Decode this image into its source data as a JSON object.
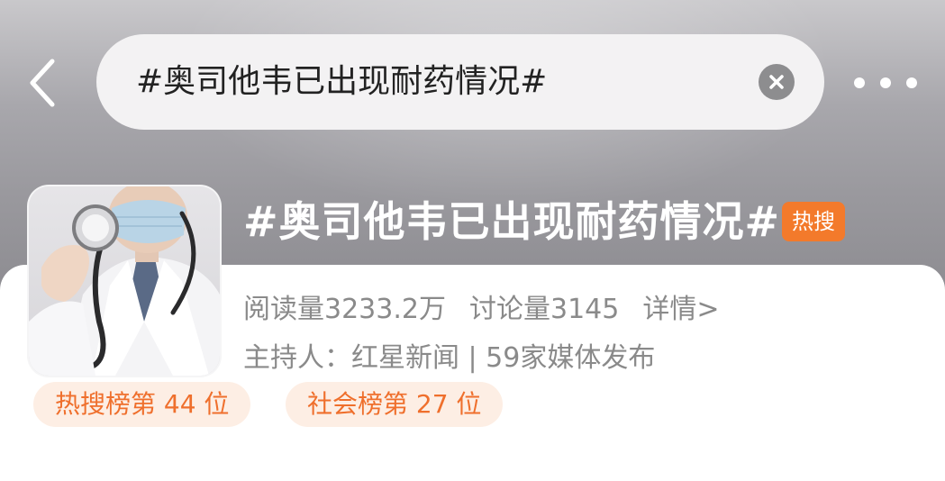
{
  "header": {
    "back_icon": "chevron-left-icon",
    "search_value": "#奥司他韦已出现耐药情况#",
    "clear_icon": "clear-icon",
    "more_icon": "more-icon"
  },
  "topic": {
    "title": "#奥司他韦已出现耐药情况#",
    "badge": "热搜",
    "badge_color": "#f37a2b",
    "cover_icon": "doctor-stethoscope-image",
    "reads": "阅读量3233.2万",
    "discussions": "讨论量3145",
    "details": "详情>",
    "host": "主持人：红星新闻 | 59家媒体发布"
  },
  "ranks": [
    {
      "label": "热搜榜第 44 位"
    },
    {
      "label": "社会榜第 27 位"
    }
  ],
  "colors": {
    "accent": "#ef6f2c",
    "chip_bg": "#fdeee4",
    "muted_text": "#8a8a8a"
  }
}
